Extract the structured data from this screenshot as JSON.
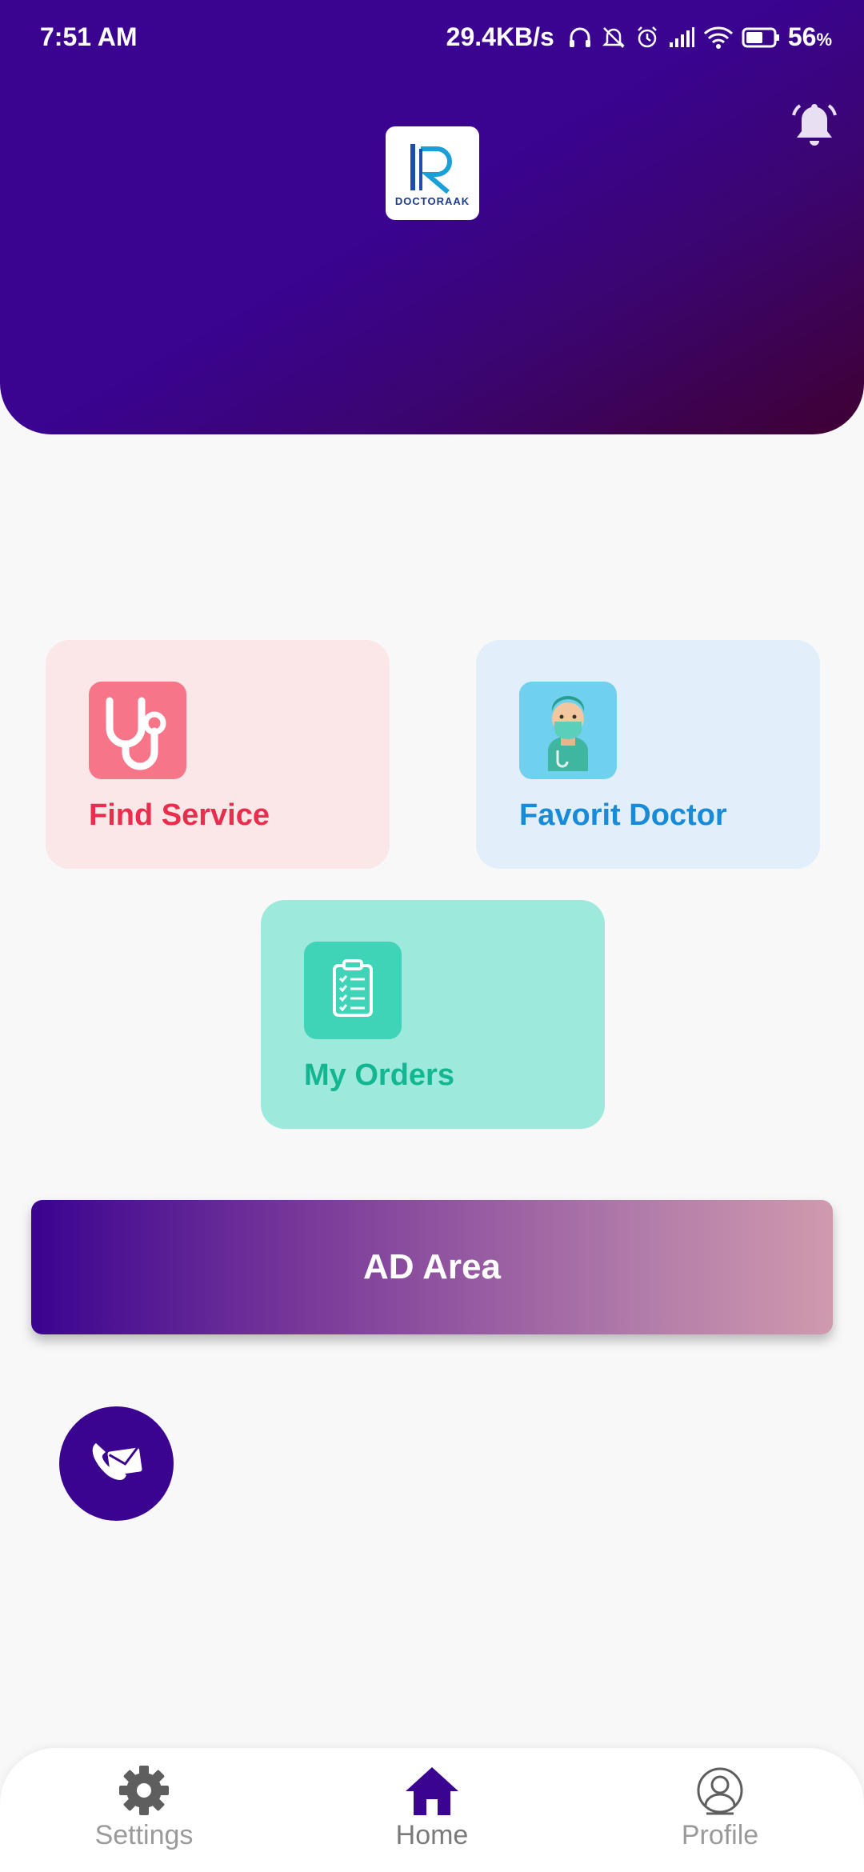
{
  "status_bar": {
    "time": "7:51 AM",
    "network_speed": "29.4KB/s",
    "battery": "56",
    "battery_unit": "%",
    "icons": [
      "headphones-icon",
      "notifications-off-icon",
      "alarm-icon",
      "signal-icon",
      "wifi-icon",
      "battery-icon"
    ]
  },
  "header": {
    "logo_text": "DOCTORAAK",
    "logo_letter": "R",
    "notification_icon": "bell-icon",
    "colors": {
      "start": "#3a0390",
      "end": "#3f0032"
    }
  },
  "cards": [
    {
      "label": "Find Service",
      "icon": "stethoscope-icon",
      "text_color": "#ea2d4c",
      "bg": "#fbe6e8"
    },
    {
      "label": "Favorit Doctor",
      "icon": "doctor-icon",
      "text_color": "#178ad8",
      "bg": "#e2eef9"
    },
    {
      "label": "My Orders",
      "icon": "clipboard-icon",
      "text_color": "#13b690",
      "bg": "#9de9db"
    }
  ],
  "ad": {
    "label": "AD Area"
  },
  "contact_button": {
    "icon": "phone-mail-icon"
  },
  "bottom_nav": {
    "active": "Home",
    "items": [
      {
        "label": "Settings",
        "icon": "gear-icon"
      },
      {
        "label": "Home",
        "icon": "home-icon"
      },
      {
        "label": "Profile",
        "icon": "user-circle-icon"
      }
    ]
  }
}
